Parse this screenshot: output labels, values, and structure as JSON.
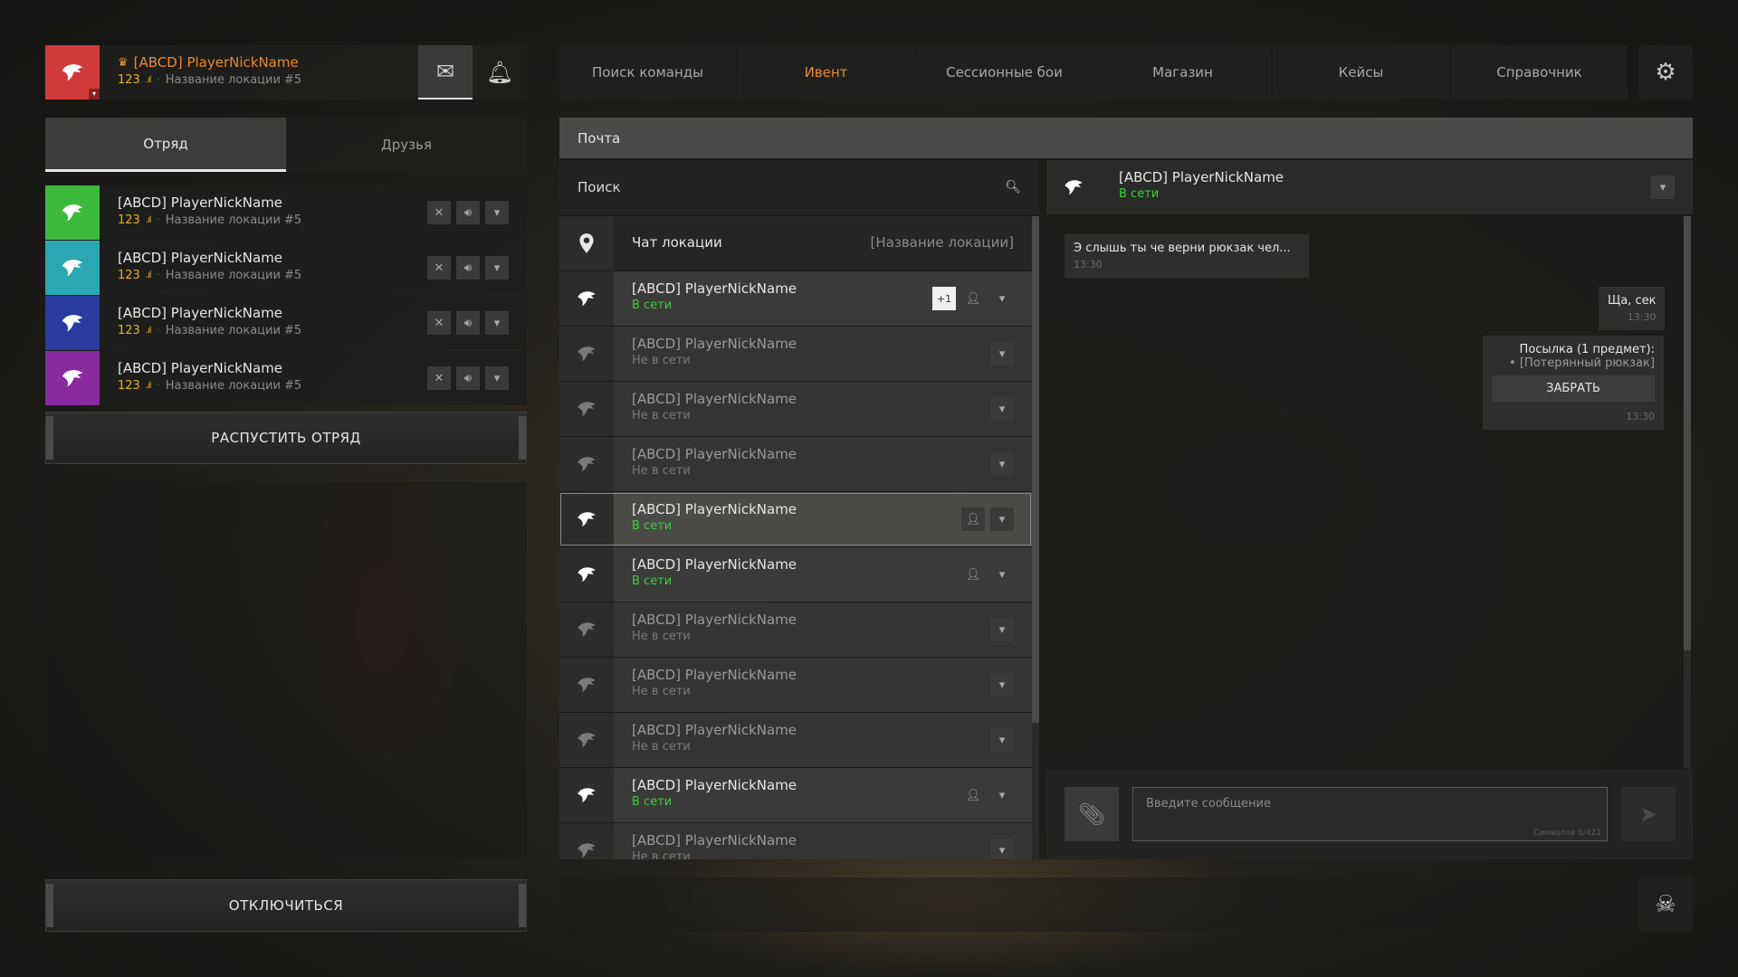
{
  "profile": {
    "name": "[ABCD] PlayerNickName",
    "level": "123",
    "location": "Название локации #5",
    "avatar_color": "#d03a3a"
  },
  "left_tabs": [
    "Отряд",
    "Друзья"
  ],
  "squad": [
    {
      "name": "[ABCD] PlayerNickName",
      "level": "123",
      "location": "Название локации #5",
      "color": "#3cba3c"
    },
    {
      "name": "[ABCD] PlayerNickName",
      "level": "123",
      "location": "Название локации #5",
      "color": "#2aa8b2"
    },
    {
      "name": "[ABCD] PlayerNickName",
      "level": "123",
      "location": "Название локации #5",
      "color": "#2a3ca0"
    },
    {
      "name": "[ABCD] PlayerNickName",
      "level": "123",
      "location": "Название локации #5",
      "color": "#8a2aa0"
    }
  ],
  "buttons": {
    "disband": "РАСПУСТИТЬ ОТРЯД",
    "disconnect": "ОТКЛЮЧИТЬСЯ"
  },
  "nav": [
    "Поиск команды",
    "Ивент",
    "Сессионные бои",
    "Магазин",
    "Кейсы",
    "Справочник"
  ],
  "nav_active": "Ивент",
  "mail": {
    "title": "Почта",
    "search_placeholder": "Поиск",
    "location_chat": {
      "label": "Чат локации",
      "location": "[Название локации]"
    },
    "contacts": [
      {
        "name": "[ABCD] PlayerNickName",
        "status": "В сети",
        "online": true,
        "badge": "+1",
        "friend": true
      },
      {
        "name": "[ABCD] PlayerNickName",
        "status": "Не в сети",
        "online": false
      },
      {
        "name": "[ABCD] PlayerNickName",
        "status": "Не в сети",
        "online": false
      },
      {
        "name": "[ABCD] PlayerNickName",
        "status": "Не в сети",
        "online": false
      },
      {
        "name": "[ABCD] PlayerNickName",
        "status": "В сети",
        "online": true,
        "friend": true,
        "selected": true
      },
      {
        "name": "[ABCD] PlayerNickName",
        "status": "В сети",
        "online": true,
        "friend": true
      },
      {
        "name": "[ABCD] PlayerNickName",
        "status": "Не в сети",
        "online": false
      },
      {
        "name": "[ABCD] PlayerNickName",
        "status": "Не в сети",
        "online": false
      },
      {
        "name": "[ABCD] PlayerNickName",
        "status": "Не в сети",
        "online": false
      },
      {
        "name": "[ABCD] PlayerNickName",
        "status": "В сети",
        "online": true,
        "friend": true
      },
      {
        "name": "[ABCD] PlayerNickName",
        "status": "Не в сети",
        "online": false
      }
    ],
    "chat": {
      "name": "[ABCD] PlayerNickName",
      "status": "В сети",
      "messages": {
        "m1": {
          "text": "Э слышь ты че верни рюкзак чел...",
          "time": "13:30"
        },
        "m2": {
          "text": "Ща, сек",
          "time": "13:30"
        },
        "m3": {
          "title": "Посылка (1 предмет):",
          "item": "• [Потерянный рюкзак]",
          "button": "ЗАБРАТЬ",
          "time": "13:30"
        }
      },
      "input_placeholder": "Введите сообщение",
      "char_counter": "Символов 0/421"
    }
  },
  "colors": {
    "accent": "#e88a30",
    "online": "#3fcf3f",
    "level": "#e8b020"
  }
}
